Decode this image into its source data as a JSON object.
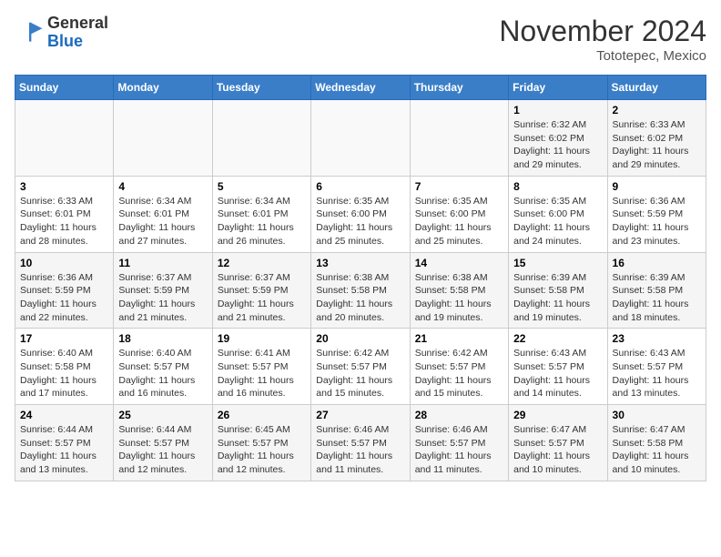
{
  "header": {
    "logo_line1": "General",
    "logo_line2": "Blue",
    "month": "November 2024",
    "location": "Tototepec, Mexico"
  },
  "days_of_week": [
    "Sunday",
    "Monday",
    "Tuesday",
    "Wednesday",
    "Thursday",
    "Friday",
    "Saturday"
  ],
  "weeks": [
    [
      {
        "day": "",
        "info": ""
      },
      {
        "day": "",
        "info": ""
      },
      {
        "day": "",
        "info": ""
      },
      {
        "day": "",
        "info": ""
      },
      {
        "day": "",
        "info": ""
      },
      {
        "day": "1",
        "info": "Sunrise: 6:32 AM\nSunset: 6:02 PM\nDaylight: 11 hours and 29 minutes."
      },
      {
        "day": "2",
        "info": "Sunrise: 6:33 AM\nSunset: 6:02 PM\nDaylight: 11 hours and 29 minutes."
      }
    ],
    [
      {
        "day": "3",
        "info": "Sunrise: 6:33 AM\nSunset: 6:01 PM\nDaylight: 11 hours and 28 minutes."
      },
      {
        "day": "4",
        "info": "Sunrise: 6:34 AM\nSunset: 6:01 PM\nDaylight: 11 hours and 27 minutes."
      },
      {
        "day": "5",
        "info": "Sunrise: 6:34 AM\nSunset: 6:01 PM\nDaylight: 11 hours and 26 minutes."
      },
      {
        "day": "6",
        "info": "Sunrise: 6:35 AM\nSunset: 6:00 PM\nDaylight: 11 hours and 25 minutes."
      },
      {
        "day": "7",
        "info": "Sunrise: 6:35 AM\nSunset: 6:00 PM\nDaylight: 11 hours and 25 minutes."
      },
      {
        "day": "8",
        "info": "Sunrise: 6:35 AM\nSunset: 6:00 PM\nDaylight: 11 hours and 24 minutes."
      },
      {
        "day": "9",
        "info": "Sunrise: 6:36 AM\nSunset: 5:59 PM\nDaylight: 11 hours and 23 minutes."
      }
    ],
    [
      {
        "day": "10",
        "info": "Sunrise: 6:36 AM\nSunset: 5:59 PM\nDaylight: 11 hours and 22 minutes."
      },
      {
        "day": "11",
        "info": "Sunrise: 6:37 AM\nSunset: 5:59 PM\nDaylight: 11 hours and 21 minutes."
      },
      {
        "day": "12",
        "info": "Sunrise: 6:37 AM\nSunset: 5:59 PM\nDaylight: 11 hours and 21 minutes."
      },
      {
        "day": "13",
        "info": "Sunrise: 6:38 AM\nSunset: 5:58 PM\nDaylight: 11 hours and 20 minutes."
      },
      {
        "day": "14",
        "info": "Sunrise: 6:38 AM\nSunset: 5:58 PM\nDaylight: 11 hours and 19 minutes."
      },
      {
        "day": "15",
        "info": "Sunrise: 6:39 AM\nSunset: 5:58 PM\nDaylight: 11 hours and 19 minutes."
      },
      {
        "day": "16",
        "info": "Sunrise: 6:39 AM\nSunset: 5:58 PM\nDaylight: 11 hours and 18 minutes."
      }
    ],
    [
      {
        "day": "17",
        "info": "Sunrise: 6:40 AM\nSunset: 5:58 PM\nDaylight: 11 hours and 17 minutes."
      },
      {
        "day": "18",
        "info": "Sunrise: 6:40 AM\nSunset: 5:57 PM\nDaylight: 11 hours and 16 minutes."
      },
      {
        "day": "19",
        "info": "Sunrise: 6:41 AM\nSunset: 5:57 PM\nDaylight: 11 hours and 16 minutes."
      },
      {
        "day": "20",
        "info": "Sunrise: 6:42 AM\nSunset: 5:57 PM\nDaylight: 11 hours and 15 minutes."
      },
      {
        "day": "21",
        "info": "Sunrise: 6:42 AM\nSunset: 5:57 PM\nDaylight: 11 hours and 15 minutes."
      },
      {
        "day": "22",
        "info": "Sunrise: 6:43 AM\nSunset: 5:57 PM\nDaylight: 11 hours and 14 minutes."
      },
      {
        "day": "23",
        "info": "Sunrise: 6:43 AM\nSunset: 5:57 PM\nDaylight: 11 hours and 13 minutes."
      }
    ],
    [
      {
        "day": "24",
        "info": "Sunrise: 6:44 AM\nSunset: 5:57 PM\nDaylight: 11 hours and 13 minutes."
      },
      {
        "day": "25",
        "info": "Sunrise: 6:44 AM\nSunset: 5:57 PM\nDaylight: 11 hours and 12 minutes."
      },
      {
        "day": "26",
        "info": "Sunrise: 6:45 AM\nSunset: 5:57 PM\nDaylight: 11 hours and 12 minutes."
      },
      {
        "day": "27",
        "info": "Sunrise: 6:46 AM\nSunset: 5:57 PM\nDaylight: 11 hours and 11 minutes."
      },
      {
        "day": "28",
        "info": "Sunrise: 6:46 AM\nSunset: 5:57 PM\nDaylight: 11 hours and 11 minutes."
      },
      {
        "day": "29",
        "info": "Sunrise: 6:47 AM\nSunset: 5:57 PM\nDaylight: 11 hours and 10 minutes."
      },
      {
        "day": "30",
        "info": "Sunrise: 6:47 AM\nSunset: 5:58 PM\nDaylight: 11 hours and 10 minutes."
      }
    ]
  ]
}
